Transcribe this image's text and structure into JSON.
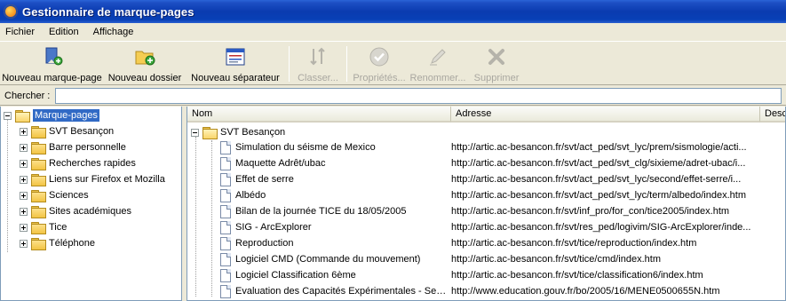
{
  "window": {
    "title": "Gestionnaire de marque-pages"
  },
  "menu": [
    "Fichier",
    "Edition",
    "Affichage"
  ],
  "toolbar": {
    "new_bookmark": "Nouveau marque-page",
    "new_folder": "Nouveau dossier",
    "new_separator": "Nouveau séparateur",
    "sort": "Classer...",
    "properties": "Propriétés...",
    "rename": "Renommer...",
    "delete": "Supprimer"
  },
  "search": {
    "label": "Chercher :",
    "value": ""
  },
  "tree": {
    "root": "Marque-pages",
    "items": [
      "SVT Besançon",
      "Barre personnelle",
      "Recherches rapides",
      "Liens sur Firefox et Mozilla",
      "Sciences",
      "Sites académiques",
      "Tice",
      "Téléphone"
    ]
  },
  "columns": {
    "name": "Nom",
    "address": "Adresse",
    "description": "Desc"
  },
  "folder_name": "SVT Besançon",
  "bookmarks": [
    {
      "name": "Simulation du séisme de Mexico",
      "url": "http://artic.ac-besancon.fr/svt/act_ped/svt_lyc/prem/sismologie/acti..."
    },
    {
      "name": "Maquette Adrêt/ubac",
      "url": "http://artic.ac-besancon.fr/svt/act_ped/svt_clg/sixieme/adret-ubac/i..."
    },
    {
      "name": "Effet de serre",
      "url": "http://artic.ac-besancon.fr/svt/act_ped/svt_lyc/second/effet-serre/i..."
    },
    {
      "name": "Albédo",
      "url": "http://artic.ac-besancon.fr/svt/act_ped/svt_lyc/term/albedo/index.htm"
    },
    {
      "name": "Bilan de la journée TICE du 18/05/2005",
      "url": "http://artic.ac-besancon.fr/svt/inf_pro/for_con/tice2005/index.htm"
    },
    {
      "name": "SIG - ArcExplorer",
      "url": "http://artic.ac-besancon.fr/svt/res_ped/logivim/SIG-ArcExplorer/inde..."
    },
    {
      "name": "Reproduction",
      "url": "http://artic.ac-besancon.fr/svt/tice/reproduction/index.htm"
    },
    {
      "name": "Logiciel CMD (Commande du mouvement)",
      "url": "http://artic.ac-besancon.fr/svt/tice/cmd/index.htm"
    },
    {
      "name": "Logiciel Classification 6ème",
      "url": "http://artic.ac-besancon.fr/svt/tice/classification6/index.htm"
    },
    {
      "name": "Evaluation des Capacités Expérimentales - Ses...",
      "url": "http://www.education.gouv.fr/bo/2005/16/MENE0500655N.htm"
    }
  ]
}
